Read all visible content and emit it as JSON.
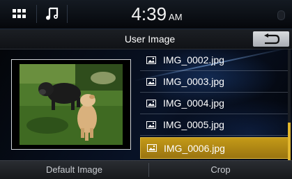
{
  "status_bar": {
    "apps_icon": "grid-icon",
    "music_icon": "music-note-icon",
    "time": "4:39",
    "ampm": "AM"
  },
  "title_bar": {
    "title": "User Image",
    "back_icon": "back-arrow-icon"
  },
  "file_list": {
    "items": [
      {
        "label": "IMG_0002.jpg",
        "icon": "image-file-icon",
        "selected": false
      },
      {
        "label": "IMG_0003.jpg",
        "icon": "image-file-icon",
        "selected": false
      },
      {
        "label": "IMG_0004.jpg",
        "icon": "image-file-icon",
        "selected": false
      },
      {
        "label": "IMG_0005.jpg",
        "icon": "image-file-icon",
        "selected": false
      },
      {
        "label": "IMG_0006.jpg",
        "icon": "image-file-icon",
        "selected": true
      }
    ]
  },
  "bottom_bar": {
    "default_image_label": "Default Image",
    "crop_label": "Crop"
  },
  "colors": {
    "selection": "#c49a18",
    "accent_scroll": "#e0b52c",
    "background": "#05070c"
  }
}
